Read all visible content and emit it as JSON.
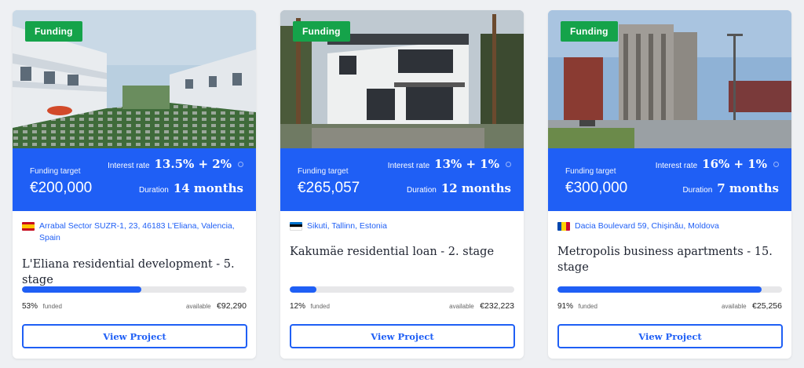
{
  "cards": [
    {
      "status_badge": "Funding",
      "funding_target_label": "Funding target",
      "funding_target": "€200,000",
      "interest_rate_label": "Interest rate",
      "interest_rate": "13.5% + 2%",
      "duration_label": "Duration",
      "duration": "14 months",
      "country_flag": "spain-flag",
      "location": "Arrabal Sector SUZR-1, 23, 46183 L'Eliana, Valencia, Spain",
      "title": "L'Eliana residential development - 5. stage",
      "funded_progress": 0.53,
      "funded_percent": "53%",
      "funded_word": "funded",
      "available_word": "available",
      "available_amount": "€92,290",
      "button_label": "View Project"
    },
    {
      "status_badge": "Funding",
      "funding_target_label": "Funding target",
      "funding_target": "€265,057",
      "interest_rate_label": "Interest rate",
      "interest_rate": "13% + 1%",
      "duration_label": "Duration",
      "duration": "12 months",
      "country_flag": "estonia-flag",
      "location": "Sikuti, Tallinn, Estonia",
      "title": "Kakumäe residential loan - 2. stage",
      "funded_progress": 0.12,
      "funded_percent": "12%",
      "funded_word": "funded",
      "available_word": "available",
      "available_amount": "€232,223",
      "button_label": "View Project"
    },
    {
      "status_badge": "Funding",
      "funding_target_label": "Funding target",
      "funding_target": "€300,000",
      "interest_rate_label": "Interest rate",
      "interest_rate": "16% + 1%",
      "duration_label": "Duration",
      "duration": "7 months",
      "country_flag": "moldova-flag",
      "location": "Dacia Boulevard 59, Chișinău, Moldova",
      "title": "Metropolis business apartments - 15. stage",
      "funded_progress": 0.91,
      "funded_percent": "91%",
      "funded_word": "funded",
      "available_word": "available",
      "available_amount": "€25,256",
      "button_label": "View Project"
    }
  ],
  "colors": {
    "accent": "#1f5ff5",
    "badge": "#15a34a",
    "track": "#e7e7e9"
  }
}
